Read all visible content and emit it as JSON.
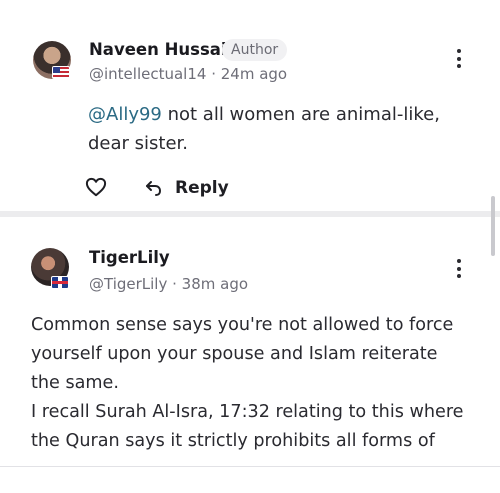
{
  "comments": [
    {
      "name": "Naveen Hussain",
      "badge": "Author",
      "handle": "@intellectual14",
      "time": "24m ago",
      "mention": "@Ally99",
      "line1": " not all women are animal-like,",
      "line2": "dear sister."
    },
    {
      "name": "TigerLily",
      "handle": "@TigerLily",
      "time": "38m ago",
      "lines": [
        "Common sense says you're not allowed to force",
        "yourself upon your spouse and Islam reiterate",
        "the same.",
        "I recall Surah Al-Isra, 17:32 relating to this where",
        "the Quran says it strictly prohibits all forms of"
      ]
    }
  ],
  "actions": {
    "reply_label": "Reply"
  },
  "meta_sep": " · ",
  "icons": {
    "like": "heart-icon",
    "reply": "reply-arrow-icon",
    "more": "more-vertical-icon",
    "flag1": "us-flag-icon",
    "flag2": "uk-flag-icon"
  }
}
